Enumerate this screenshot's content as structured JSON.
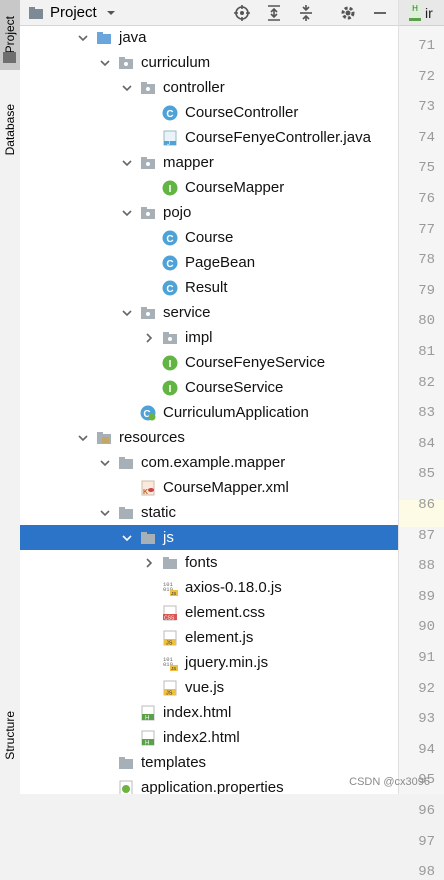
{
  "side_tabs": {
    "project": "Project",
    "database": "Database",
    "structure": "Structure"
  },
  "toolbar": {
    "title": "Project"
  },
  "editor_tab": {
    "label": "ir"
  },
  "tree": [
    {
      "label": "java",
      "icon": "folder-blue",
      "arrow": "down"
    },
    {
      "label": "curriculum",
      "icon": "package",
      "arrow": "down"
    },
    {
      "label": "controller",
      "icon": "package",
      "arrow": "down"
    },
    {
      "label": "CourseController",
      "icon": "class-c",
      "arrow": ""
    },
    {
      "label": "CourseFenyeController.java",
      "icon": "java-file",
      "arrow": ""
    },
    {
      "label": "mapper",
      "icon": "package",
      "arrow": "down"
    },
    {
      "label": "CourseMapper",
      "icon": "interface-i",
      "arrow": ""
    },
    {
      "label": "pojo",
      "icon": "package",
      "arrow": "down"
    },
    {
      "label": "Course",
      "icon": "class-c",
      "arrow": ""
    },
    {
      "label": "PageBean",
      "icon": "class-c",
      "arrow": ""
    },
    {
      "label": "Result",
      "icon": "class-c",
      "arrow": ""
    },
    {
      "label": "service",
      "icon": "package",
      "arrow": "down"
    },
    {
      "label": "impl",
      "icon": "package",
      "arrow": "right"
    },
    {
      "label": "CourseFenyeService",
      "icon": "interface-i",
      "arrow": ""
    },
    {
      "label": "CourseService",
      "icon": "interface-i",
      "arrow": ""
    },
    {
      "label": "CurriculumApplication",
      "icon": "spring-class",
      "arrow": ""
    },
    {
      "label": "resources",
      "icon": "folder-resources",
      "arrow": "down"
    },
    {
      "label": "com.example.mapper",
      "icon": "folder-gray",
      "arrow": "down"
    },
    {
      "label": "CourseMapper.xml",
      "icon": "xml-file",
      "arrow": ""
    },
    {
      "label": "static",
      "icon": "folder-gray",
      "arrow": "down"
    },
    {
      "label": "js",
      "icon": "folder-gray",
      "arrow": "down",
      "selected": true
    },
    {
      "label": "fonts",
      "icon": "folder-gray",
      "arrow": "right"
    },
    {
      "label": "axios-0.18.0.js",
      "icon": "js-binary",
      "arrow": ""
    },
    {
      "label": "element.css",
      "icon": "css-file",
      "arrow": ""
    },
    {
      "label": "element.js",
      "icon": "js-file",
      "arrow": ""
    },
    {
      "label": "jquery.min.js",
      "icon": "js-binary",
      "arrow": ""
    },
    {
      "label": "vue.js",
      "icon": "js-file",
      "arrow": ""
    },
    {
      "label": "index.html",
      "icon": "html-file",
      "arrow": ""
    },
    {
      "label": "index2.html",
      "icon": "html-file",
      "arrow": ""
    },
    {
      "label": "templates",
      "icon": "folder-gray",
      "arrow": ""
    },
    {
      "label": "application.properties",
      "icon": "properties-file",
      "arrow": ""
    }
  ],
  "line_numbers": [
    "71",
    "72",
    "73",
    "74",
    "75",
    "76",
    "77",
    "78",
    "79",
    "80",
    "81",
    "82",
    "83",
    "84",
    "85",
    "86",
    "87",
    "88",
    "89",
    "90",
    "91",
    "92",
    "93",
    "94",
    "95",
    "96",
    "97",
    "98"
  ],
  "watermark": "CSDN @cx3096"
}
